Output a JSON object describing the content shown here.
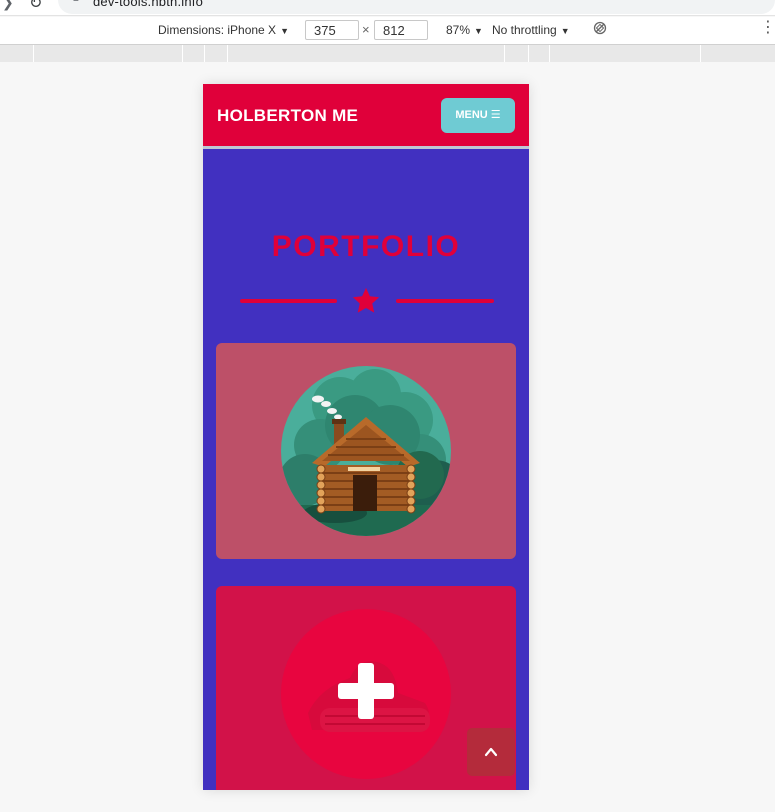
{
  "browser": {
    "url": "dev-tools.hbtn.info"
  },
  "device_toolbar": {
    "dimensions_label": "Dimensions: iPhone X",
    "width": "375",
    "height": "812",
    "times": "×",
    "zoom": "87%",
    "throttling": "No throttling"
  },
  "site": {
    "brand": "HOLBERTON ME",
    "menu_label": "MENU",
    "section_title": "PORTFOLIO",
    "colors": {
      "primary": "#e0003a",
      "background": "#4130c0",
      "menu_button": "#6fcbd3",
      "card_one": "#bd5068",
      "card_two": "#d21249"
    },
    "portfolio_items": [
      {
        "icon": "log-cabin-icon"
      },
      {
        "icon": "plus-icon"
      }
    ]
  },
  "icons": {
    "menu": "bars-icon",
    "divider": "star-icon",
    "scroll_top": "chevron-up-icon",
    "rotate": "rotate-icon",
    "more": "more-vertical-icon"
  }
}
